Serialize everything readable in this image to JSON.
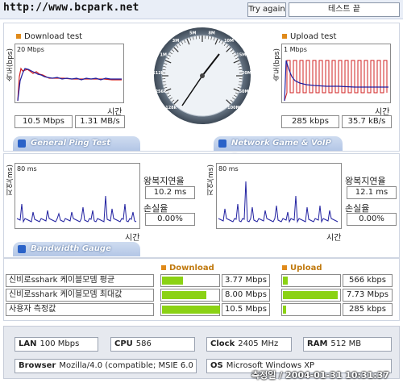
{
  "header": {
    "site_url": "http://www.bcpark.net",
    "try_again_label": "Try again",
    "status_label": "테스트 끝"
  },
  "download": {
    "title": "Download test",
    "axis_label": "속도(bps)",
    "scale": "20 Mbps",
    "time_label": "시간",
    "value_mbps": "10.5 Mbps",
    "value_mbs": "1.31 MB/s"
  },
  "upload": {
    "title": "Upload test",
    "axis_label": "속도(bps)",
    "scale": "1 Mbps",
    "time_label": "시간",
    "value_kbps": "285 kbps",
    "value_kbs": "35.7 kB/s"
  },
  "gauge": {
    "ticks": [
      "128k",
      "256k",
      "512k",
      "1M",
      "3M",
      "5M",
      "8M",
      "10M",
      "15M",
      "20M",
      "50M",
      "100M"
    ],
    "needle_value": "10M"
  },
  "tabs": {
    "ping": "General Ping Test",
    "game": "Network Game & VoIP Test",
    "bandwidth": "Bandwidth Gauge"
  },
  "ping": {
    "axis_label": "지연(ms)",
    "scale": "80 ms",
    "time_label": "시간",
    "rtt_label": "왕복지연율",
    "rtt_value": "10.2 ms",
    "loss_label": "손실율",
    "loss_value": "0.00%"
  },
  "game": {
    "axis_label": "지연(ms)",
    "scale": "80 ms",
    "time_label": "시간",
    "rtt_label": "왕복지연율",
    "rtt_value": "12.1 ms",
    "loss_label": "손실율",
    "loss_value": "0.00%"
  },
  "bandwidth": {
    "download_header": "Download",
    "upload_header": "Upload",
    "rows": [
      {
        "label": "신비로sshark 케이블모뎀 평균",
        "down": "3.77 Mbps",
        "down_fraction": 0.36,
        "up": "566 kbps",
        "up_fraction": 0.08
      },
      {
        "label": "신비로sshark 케이블모뎀 최대값",
        "down": "8.00 Mbps",
        "down_fraction": 0.76,
        "up": "7.73 Mbps",
        "up_fraction": 0.95
      },
      {
        "label": "사용자 측정값",
        "down": "10.5 Mbps",
        "down_fraction": 1.0,
        "up": "285 kbps",
        "up_fraction": 0.05
      }
    ]
  },
  "system": {
    "lan_label": "LAN",
    "lan_value": "100 Mbps",
    "cpu_label": "CPU",
    "cpu_value": "586",
    "clock_label": "Clock",
    "clock_value": "2405 MHz",
    "ram_label": "RAM",
    "ram_value": "512 MB",
    "browser_label": "Browser",
    "browser_value": "Mozilla/4.0 (compatible; MSIE 6.0",
    "os_label": "OS",
    "os_value": "Microsoft Windows XP",
    "timestamp": "측정일 / 2004-01-31 10:31:37"
  },
  "colors": {
    "accent_orange": "#e08a1a",
    "bar_green": "#8bd214",
    "series_red": "#d02020",
    "series_blue": "#2020a0"
  }
}
